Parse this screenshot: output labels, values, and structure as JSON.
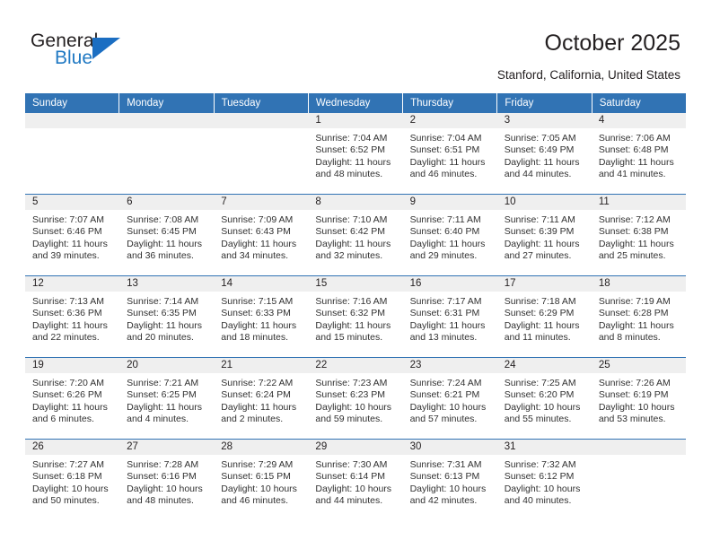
{
  "brand": {
    "name_part1": "General",
    "name_part2": "Blue",
    "triangle_color": "#1b6ec2",
    "blue_color": "#2079c3"
  },
  "header": {
    "title": "October 2025",
    "subtitle": "Stanford, California, United States",
    "accent_color": "#3173b4",
    "daynum_row_color": "#efefef"
  },
  "weekdays": [
    "Sunday",
    "Monday",
    "Tuesday",
    "Wednesday",
    "Thursday",
    "Friday",
    "Saturday"
  ],
  "labels": {
    "sunrise": "Sunrise:",
    "sunset": "Sunset:",
    "daylight": "Daylight:"
  },
  "weeks": [
    [
      {
        "day": "",
        "sunrise": "",
        "sunset": "",
        "daylight": ""
      },
      {
        "day": "",
        "sunrise": "",
        "sunset": "",
        "daylight": ""
      },
      {
        "day": "",
        "sunrise": "",
        "sunset": "",
        "daylight": ""
      },
      {
        "day": "1",
        "sunrise": "Sunrise: 7:04 AM",
        "sunset": "Sunset: 6:52 PM",
        "daylight": "Daylight: 11 hours and 48 minutes."
      },
      {
        "day": "2",
        "sunrise": "Sunrise: 7:04 AM",
        "sunset": "Sunset: 6:51 PM",
        "daylight": "Daylight: 11 hours and 46 minutes."
      },
      {
        "day": "3",
        "sunrise": "Sunrise: 7:05 AM",
        "sunset": "Sunset: 6:49 PM",
        "daylight": "Daylight: 11 hours and 44 minutes."
      },
      {
        "day": "4",
        "sunrise": "Sunrise: 7:06 AM",
        "sunset": "Sunset: 6:48 PM",
        "daylight": "Daylight: 11 hours and 41 minutes."
      }
    ],
    [
      {
        "day": "5",
        "sunrise": "Sunrise: 7:07 AM",
        "sunset": "Sunset: 6:46 PM",
        "daylight": "Daylight: 11 hours and 39 minutes."
      },
      {
        "day": "6",
        "sunrise": "Sunrise: 7:08 AM",
        "sunset": "Sunset: 6:45 PM",
        "daylight": "Daylight: 11 hours and 36 minutes."
      },
      {
        "day": "7",
        "sunrise": "Sunrise: 7:09 AM",
        "sunset": "Sunset: 6:43 PM",
        "daylight": "Daylight: 11 hours and 34 minutes."
      },
      {
        "day": "8",
        "sunrise": "Sunrise: 7:10 AM",
        "sunset": "Sunset: 6:42 PM",
        "daylight": "Daylight: 11 hours and 32 minutes."
      },
      {
        "day": "9",
        "sunrise": "Sunrise: 7:11 AM",
        "sunset": "Sunset: 6:40 PM",
        "daylight": "Daylight: 11 hours and 29 minutes."
      },
      {
        "day": "10",
        "sunrise": "Sunrise: 7:11 AM",
        "sunset": "Sunset: 6:39 PM",
        "daylight": "Daylight: 11 hours and 27 minutes."
      },
      {
        "day": "11",
        "sunrise": "Sunrise: 7:12 AM",
        "sunset": "Sunset: 6:38 PM",
        "daylight": "Daylight: 11 hours and 25 minutes."
      }
    ],
    [
      {
        "day": "12",
        "sunrise": "Sunrise: 7:13 AM",
        "sunset": "Sunset: 6:36 PM",
        "daylight": "Daylight: 11 hours and 22 minutes."
      },
      {
        "day": "13",
        "sunrise": "Sunrise: 7:14 AM",
        "sunset": "Sunset: 6:35 PM",
        "daylight": "Daylight: 11 hours and 20 minutes."
      },
      {
        "day": "14",
        "sunrise": "Sunrise: 7:15 AM",
        "sunset": "Sunset: 6:33 PM",
        "daylight": "Daylight: 11 hours and 18 minutes."
      },
      {
        "day": "15",
        "sunrise": "Sunrise: 7:16 AM",
        "sunset": "Sunset: 6:32 PM",
        "daylight": "Daylight: 11 hours and 15 minutes."
      },
      {
        "day": "16",
        "sunrise": "Sunrise: 7:17 AM",
        "sunset": "Sunset: 6:31 PM",
        "daylight": "Daylight: 11 hours and 13 minutes."
      },
      {
        "day": "17",
        "sunrise": "Sunrise: 7:18 AM",
        "sunset": "Sunset: 6:29 PM",
        "daylight": "Daylight: 11 hours and 11 minutes."
      },
      {
        "day": "18",
        "sunrise": "Sunrise: 7:19 AM",
        "sunset": "Sunset: 6:28 PM",
        "daylight": "Daylight: 11 hours and 8 minutes."
      }
    ],
    [
      {
        "day": "19",
        "sunrise": "Sunrise: 7:20 AM",
        "sunset": "Sunset: 6:26 PM",
        "daylight": "Daylight: 11 hours and 6 minutes."
      },
      {
        "day": "20",
        "sunrise": "Sunrise: 7:21 AM",
        "sunset": "Sunset: 6:25 PM",
        "daylight": "Daylight: 11 hours and 4 minutes."
      },
      {
        "day": "21",
        "sunrise": "Sunrise: 7:22 AM",
        "sunset": "Sunset: 6:24 PM",
        "daylight": "Daylight: 11 hours and 2 minutes."
      },
      {
        "day": "22",
        "sunrise": "Sunrise: 7:23 AM",
        "sunset": "Sunset: 6:23 PM",
        "daylight": "Daylight: 10 hours and 59 minutes."
      },
      {
        "day": "23",
        "sunrise": "Sunrise: 7:24 AM",
        "sunset": "Sunset: 6:21 PM",
        "daylight": "Daylight: 10 hours and 57 minutes."
      },
      {
        "day": "24",
        "sunrise": "Sunrise: 7:25 AM",
        "sunset": "Sunset: 6:20 PM",
        "daylight": "Daylight: 10 hours and 55 minutes."
      },
      {
        "day": "25",
        "sunrise": "Sunrise: 7:26 AM",
        "sunset": "Sunset: 6:19 PM",
        "daylight": "Daylight: 10 hours and 53 minutes."
      }
    ],
    [
      {
        "day": "26",
        "sunrise": "Sunrise: 7:27 AM",
        "sunset": "Sunset: 6:18 PM",
        "daylight": "Daylight: 10 hours and 50 minutes."
      },
      {
        "day": "27",
        "sunrise": "Sunrise: 7:28 AM",
        "sunset": "Sunset: 6:16 PM",
        "daylight": "Daylight: 10 hours and 48 minutes."
      },
      {
        "day": "28",
        "sunrise": "Sunrise: 7:29 AM",
        "sunset": "Sunset: 6:15 PM",
        "daylight": "Daylight: 10 hours and 46 minutes."
      },
      {
        "day": "29",
        "sunrise": "Sunrise: 7:30 AM",
        "sunset": "Sunset: 6:14 PM",
        "daylight": "Daylight: 10 hours and 44 minutes."
      },
      {
        "day": "30",
        "sunrise": "Sunrise: 7:31 AM",
        "sunset": "Sunset: 6:13 PM",
        "daylight": "Daylight: 10 hours and 42 minutes."
      },
      {
        "day": "31",
        "sunrise": "Sunrise: 7:32 AM",
        "sunset": "Sunset: 6:12 PM",
        "daylight": "Daylight: 10 hours and 40 minutes."
      },
      {
        "day": "",
        "sunrise": "",
        "sunset": "",
        "daylight": ""
      }
    ]
  ]
}
